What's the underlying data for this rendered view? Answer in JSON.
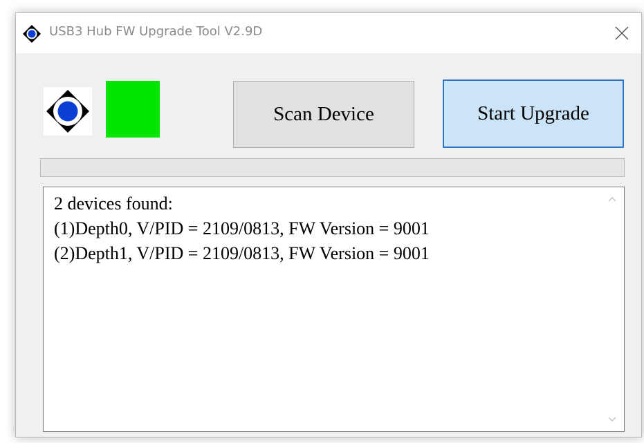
{
  "window": {
    "title": "USB3 Hub FW Upgrade Tool V2.9D",
    "close_icon": "close-icon",
    "app_icon": "hub-logo-icon"
  },
  "status": {
    "indicator_color": "#00e600"
  },
  "buttons": {
    "scan_label": "Scan Device",
    "upgrade_label": "Start Upgrade"
  },
  "progress": {
    "value": 0
  },
  "log": {
    "lines": [
      "2 devices found:",
      "(1)Depth0, V/PID = 2109/0813, FW Version = 9001",
      "(2)Depth1, V/PID = 2109/0813, FW Version = 9001"
    ]
  },
  "colors": {
    "accent": "#2c78c7",
    "primary_button_bg": "#cce4f7",
    "status_ok": "#00e600"
  }
}
